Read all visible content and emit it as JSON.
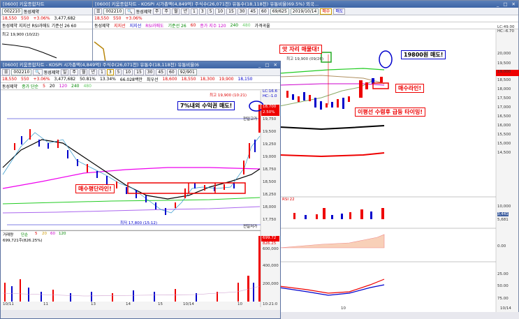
{
  "back": {
    "title": "[0600] 키움종합차트 - KOSPI 시가총액(4,849억) 주식수(26,071천) 유통수(18,118천) 유통비율(69.5%) 외국...",
    "code": "002210",
    "name": "동성제약",
    "periods": [
      "주",
      "주",
      "월",
      "년",
      "1",
      "3",
      "5",
      "10",
      "15",
      "30",
      "45",
      "60"
    ],
    "count": "69/625",
    "date": "2019/10/14",
    "buy": "매수",
    "sell": "매도",
    "price": "18,550",
    "change": "550",
    "rate": "+3.06%",
    "ind_label": "동성제약",
    "ind_items": [
      "지지선",
      "지지선",
      "RSI과매도",
      "기준선 26",
      "60",
      "종가 지수 120",
      "240",
      "480",
      "가격곡율"
    ],
    "high_label": "최고 19,900 (09/26)",
    "rsi_label": "RSI 22",
    "axis_main": [
      "20,000",
      "19,500",
      "19,000",
      "18,500",
      "18,000",
      "17,500",
      "17,000",
      "16,500",
      "16,000",
      "15,500",
      "15,000",
      "14,500"
    ],
    "axis_lower": [
      "10,000",
      "3,441",
      "5,681",
      "0.00",
      "25.00",
      "50.00",
      "75.00"
    ],
    "lc": "LC:49.00",
    "hc": "HC:-6.70",
    "foot": "10",
    "foot_right": "10/14"
  },
  "left": {
    "title": "[0600] 키움종합차트",
    "code": "002210",
    "name": "동성제약",
    "price": "18,550",
    "change": "550",
    "rate": "+3.06%",
    "volume": "3,477,682",
    "ind": "동성제약 지지선 RSI과매도 기준선 26 60",
    "sub": "최고 19,900 (10/22)"
  },
  "front": {
    "title": "[0600] 키움종합차트 - KOSPI 시가총액(4,849억) 주식수(26,071천) 유통수(18,118천) 유통비율(6",
    "code": "002210",
    "name": "동성제약",
    "tabs": [
      "일",
      "주",
      "월",
      "년",
      "1",
      "3",
      "5",
      "10",
      "15",
      "30",
      "45",
      "60"
    ],
    "count": "92/901",
    "price": "18,550",
    "change": "550",
    "rate": "+3.06%",
    "volume": "3,477,682",
    "pct": "50.81%",
    "ratio": "13.34%",
    "amount": "66.028백만",
    "quotes": [
      "최우선",
      "18,600",
      "18,550",
      "18,300",
      "19,900",
      "18,150"
    ],
    "ind": [
      "동성제약",
      "종가 단순",
      "5",
      "20",
      "120",
      "240",
      "480"
    ],
    "high": "최고 19,900 (10:21)",
    "low": "최저 17,800 (15:12)",
    "upper_band": "전일고가",
    "lower_band": "전일저가",
    "axis": [
      "19,750",
      "19,500",
      "19,250",
      "19,000",
      "18,750",
      "18,500",
      "18,250",
      "18,000",
      "17,750"
    ],
    "lc": "LC:16.6",
    "hc": "HC:-1.0",
    "tag_price": "18,700",
    "tag_pct": "2.50%",
    "vol_title": "거래량",
    "vol_ind": [
      "단순",
      "5",
      "20",
      "60",
      "120"
    ],
    "vol_value": "699,721주(826.25%)",
    "vol_axis": [
      "600,000",
      "400,000",
      "200,000"
    ],
    "vol_tag": "699.72",
    "vol_tag2": "826.25",
    "dates": [
      "10/11",
      "11",
      "13",
      "14",
      "15",
      "10/14",
      "10",
      "10:21:0"
    ]
  },
  "annotations": {
    "seat": "앗 자리 매물대!",
    "target": "19800원 매도!",
    "profit": "7%내외 수익권 매도!",
    "buyline": "매수라인!",
    "timing": "이평선 수렴후 급등 타이밍!",
    "buylines": "매수평단라인!"
  }
}
